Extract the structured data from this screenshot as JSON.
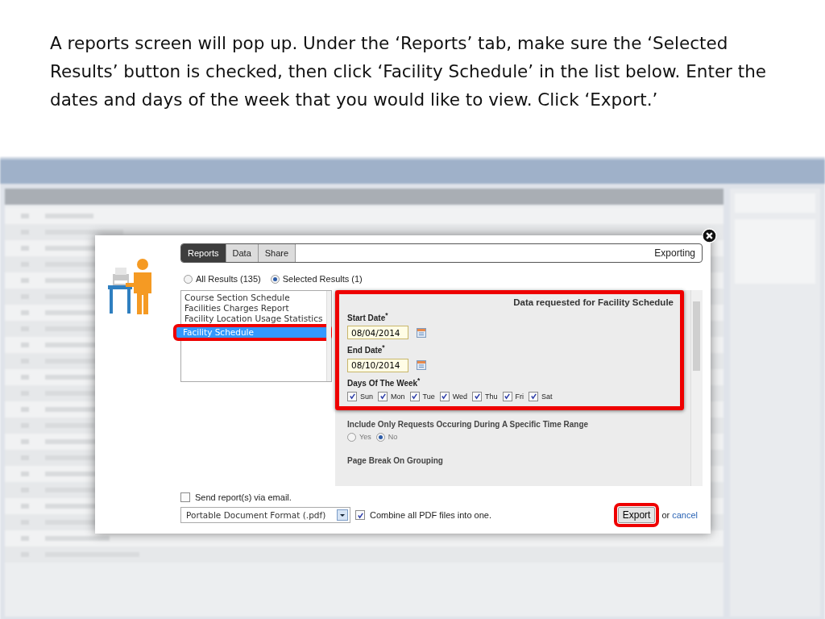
{
  "instruction": "A reports screen will pop up. Under the ‘Reports’ tab, make sure the ‘Selected Results’ button is checked, then click ‘Facility Schedule’ in the list below. Enter the dates and days of the week that you would like to view. Click ‘Export.’",
  "dialog": {
    "tabs": [
      {
        "label": "Reports",
        "selected": true
      },
      {
        "label": "Data",
        "selected": false
      },
      {
        "label": "Share",
        "selected": false
      }
    ],
    "status": "Exporting",
    "scope_options": [
      {
        "label": "All Results (135)",
        "selected": false
      },
      {
        "label": "Selected Results (1)",
        "selected": true
      }
    ],
    "reports": [
      {
        "label": "Course Section Schedule",
        "selected": false,
        "highlighted": false
      },
      {
        "label": "Facilities Charges Report",
        "selected": false,
        "highlighted": false
      },
      {
        "label": "Facility Location Usage Statistics",
        "selected": false,
        "highlighted": false
      },
      {
        "label": "Facility Schedule",
        "selected": true,
        "highlighted": true
      }
    ],
    "parameters": {
      "highlighted": true,
      "heading": "Data requested for Facility Schedule",
      "dates": [
        {
          "label": "Start Date$^{*}$",
          "value": "08/04/2014"
        },
        {
          "label": "End Date$^{*}$",
          "value": "08/10/2014"
        }
      ],
      "days_label": "Days Of The Week$^{*}$",
      "days": [
        {
          "label": "Sun",
          "checked": true
        },
        {
          "label": "Mon",
          "checked": true
        },
        {
          "label": "Tue",
          "checked": true
        },
        {
          "label": "Wed",
          "checked": true
        },
        {
          "label": "Thu",
          "checked": true
        },
        {
          "label": "Fri",
          "checked": true
        },
        {
          "label": "Sat",
          "checked": true
        }
      ],
      "time_range_label": "Include Only Requests Occuring During A Specific Time Range",
      "time_range_options": [
        {
          "label": "Yes",
          "selected": false
        },
        {
          "label": "No",
          "selected": true
        }
      ],
      "page_break_label": "Page Break On Grouping"
    },
    "email": {
      "label": "Send report(s) via email.",
      "checked": false
    },
    "format": {
      "value": "Portable Document Format (.pdf)"
    },
    "combine": {
      "label": "Combine all PDF files into one.",
      "checked": true
    },
    "export": {
      "label": "Export",
      "highlighted": true
    },
    "or_text": "or",
    "cancel": "cancel"
  }
}
